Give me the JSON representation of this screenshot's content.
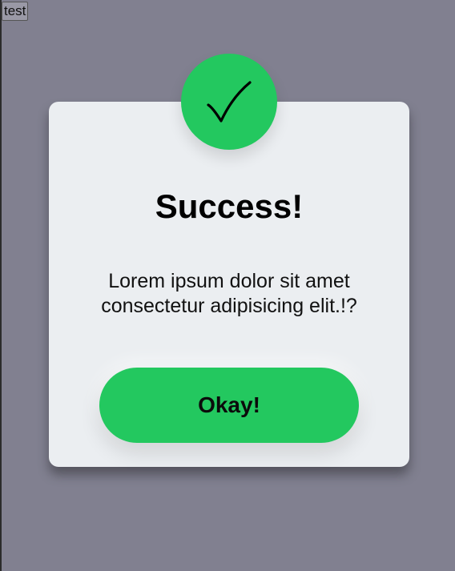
{
  "test_button": {
    "label": "test"
  },
  "modal": {
    "title": "Success!",
    "message_line1": "Lorem ipsum dolor sit amet",
    "message_line2": "consectetur adipisicing elit.!?",
    "ok_label": "Okay!",
    "icon": "checkmark-icon"
  },
  "colors": {
    "background": "#818090",
    "modal_background": "#ebeef1",
    "accent": "#23c85f"
  }
}
